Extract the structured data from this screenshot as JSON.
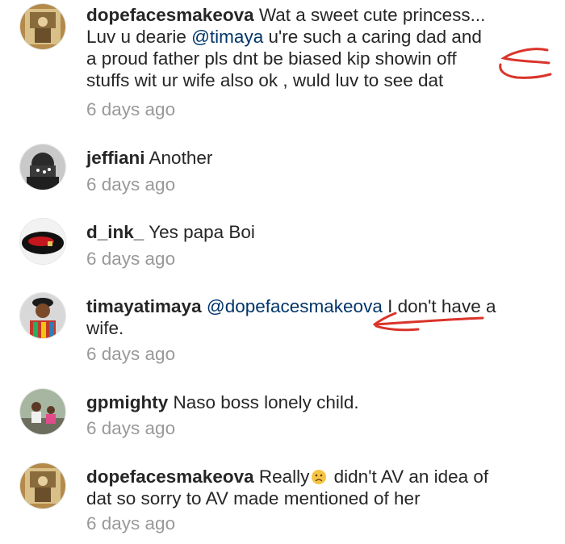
{
  "comments": [
    {
      "username": "dopefacesmakeova",
      "segments": [
        {
          "type": "text",
          "value": "Wat a sweet cute princess..."
        },
        {
          "type": "break"
        },
        {
          "type": "text",
          "value": "Luv u dearie "
        },
        {
          "type": "mention",
          "value": "@timaya"
        },
        {
          "type": "text",
          "value": " u're such a caring dad and"
        },
        {
          "type": "break"
        },
        {
          "type": "text",
          "value": "a proud father pls dnt be biased kip showin  off"
        },
        {
          "type": "break"
        },
        {
          "type": "text",
          "value": "stuffs wit ur wife also ok , wuld luv to see dat"
        }
      ],
      "time": "6 days ago",
      "avatar_icon": "avatar-dopefacesmakeova"
    },
    {
      "username": "jeffiani",
      "segments": [
        {
          "type": "text",
          "value": "Another"
        }
      ],
      "time": "6 days ago",
      "avatar_icon": "avatar-jeffiani"
    },
    {
      "username": "d_ink_",
      "segments": [
        {
          "type": "text",
          "value": "Yes papa Boi"
        }
      ],
      "time": "6 days ago",
      "avatar_icon": "avatar-d-ink"
    },
    {
      "username": "timayatimaya",
      "segments": [
        {
          "type": "mention",
          "value": "@dopefacesmakeova"
        },
        {
          "type": "text",
          "value": " I don't have a"
        },
        {
          "type": "break"
        },
        {
          "type": "text",
          "value": "wife."
        }
      ],
      "time": "6 days ago",
      "avatar_icon": "avatar-timayatimaya"
    },
    {
      "username": "gpmighty",
      "segments": [
        {
          "type": "text",
          "value": "Naso boss lonely child."
        }
      ],
      "time": "6 days ago",
      "avatar_icon": "avatar-gpmighty"
    },
    {
      "username": "dopefacesmakeova",
      "segments": [
        {
          "type": "text",
          "value": "Really"
        },
        {
          "type": "emoji",
          "value": "disappointed-face"
        },
        {
          "type": "text",
          "value": " didn't AV an idea of"
        },
        {
          "type": "break"
        },
        {
          "type": "text",
          "value": "dat so sorry to AV made mentioned of her"
        }
      ],
      "time": "6 days ago",
      "avatar_icon": "avatar-dopefacesmakeova"
    }
  ],
  "colors": {
    "username": "#262626",
    "mention": "#003569",
    "timestamp": "#999999",
    "annotation": "#d9342b"
  }
}
